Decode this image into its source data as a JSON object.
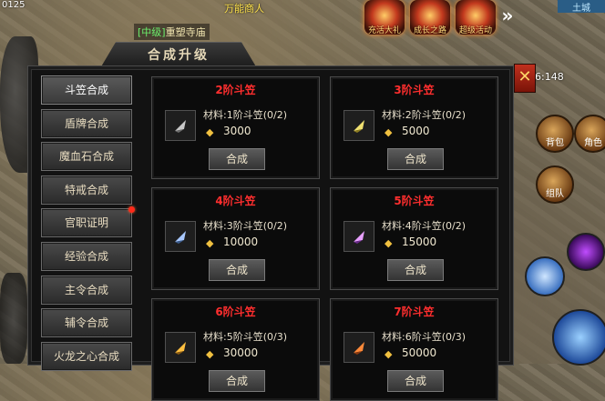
{
  "scene": {
    "top_left_text": "0125",
    "map_level": "[中级]",
    "map_name": "重塑寺庙",
    "npc_name": "万能商人",
    "coords": "6:148",
    "server_tag": "土城",
    "top_icons": [
      {
        "name": "gift-icon",
        "label": "充活大礼"
      },
      {
        "name": "chest-icon",
        "label": "成长之路"
      },
      {
        "name": "fire-icon",
        "label": "超级活动"
      }
    ],
    "round_buttons": [
      "背包",
      "角色",
      "组队"
    ]
  },
  "panel": {
    "title": "合成升级",
    "close_symbol": "✕",
    "sidebar": [
      {
        "label": "斗笠合成",
        "active": true,
        "dot": false
      },
      {
        "label": "盾牌合成",
        "active": false,
        "dot": false
      },
      {
        "label": "魔血石合成",
        "active": false,
        "dot": false
      },
      {
        "label": "特戒合成",
        "active": false,
        "dot": false
      },
      {
        "label": "官职证明",
        "active": false,
        "dot": true
      },
      {
        "label": "经验合成",
        "active": false,
        "dot": false
      },
      {
        "label": "主令合成",
        "active": false,
        "dot": false
      },
      {
        "label": "辅令合成",
        "active": false,
        "dot": false
      },
      {
        "label": "火龙之心合成",
        "active": false,
        "dot": false
      }
    ],
    "cards": [
      {
        "title": "2阶斗笠",
        "material": "材料:1阶斗笠(0/2)",
        "cost": "3000",
        "button": "合成"
      },
      {
        "title": "3阶斗笠",
        "material": "材料:2阶斗笠(0/2)",
        "cost": "5000",
        "button": "合成"
      },
      {
        "title": "4阶斗笠",
        "material": "材料:3阶斗笠(0/2)",
        "cost": "10000",
        "button": "合成"
      },
      {
        "title": "5阶斗笠",
        "material": "材料:4阶斗笠(0/2)",
        "cost": "15000",
        "button": "合成"
      },
      {
        "title": "6阶斗笠",
        "material": "材料:5阶斗笠(0/3)",
        "cost": "30000",
        "button": "合成"
      },
      {
        "title": "7阶斗笠",
        "material": "材料:6阶斗笠(0/3)",
        "cost": "50000",
        "button": "合成"
      }
    ],
    "colors": {
      "title_red": "#ff2e2e",
      "gold": "#f0c040"
    }
  }
}
